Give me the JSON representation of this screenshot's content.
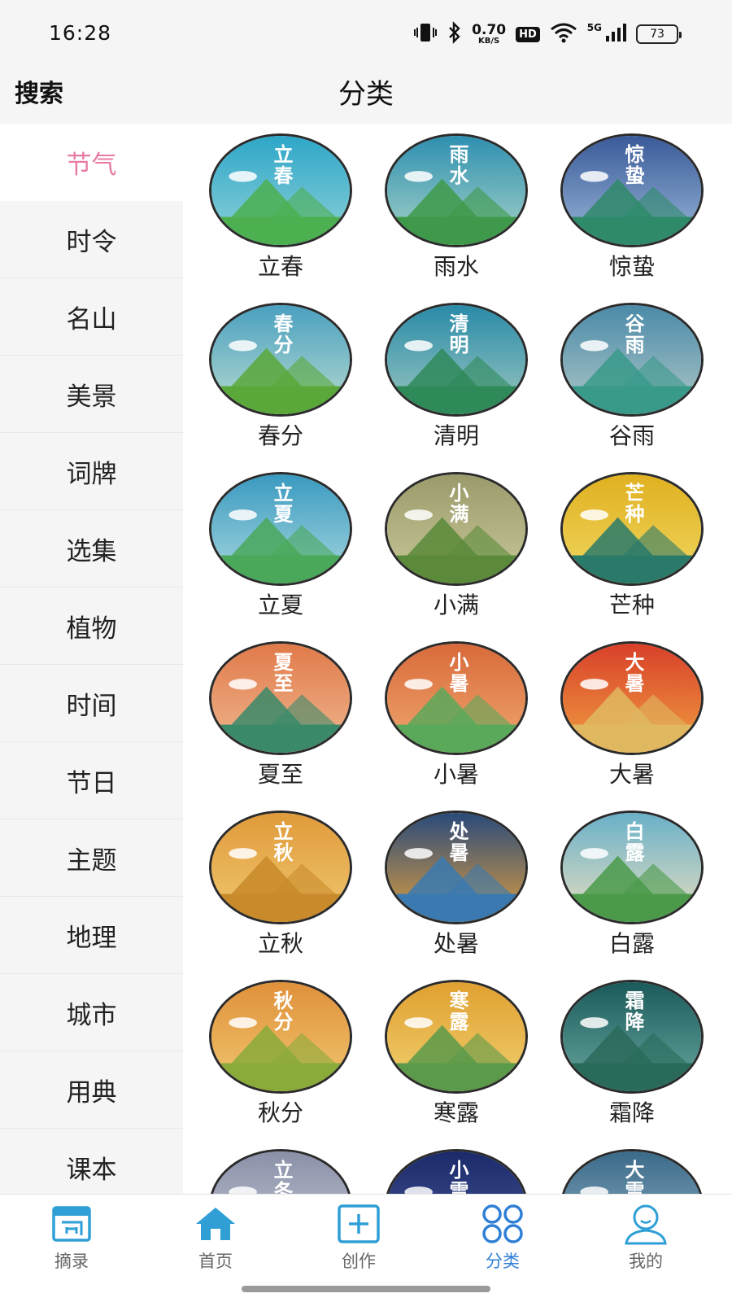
{
  "status": {
    "time": "16:28",
    "speed_value": "0.70",
    "speed_unit": "KB/S",
    "hd": "HD",
    "network": "5G",
    "battery": "73"
  },
  "header": {
    "search_label": "搜索",
    "title": "分类"
  },
  "sidebar": {
    "active_index": 0,
    "items": [
      {
        "label": "节气"
      },
      {
        "label": "时令"
      },
      {
        "label": "名山"
      },
      {
        "label": "美景"
      },
      {
        "label": "词牌"
      },
      {
        "label": "选集"
      },
      {
        "label": "植物"
      },
      {
        "label": "时间"
      },
      {
        "label": "节日"
      },
      {
        "label": "主题"
      },
      {
        "label": "地理"
      },
      {
        "label": "城市"
      },
      {
        "label": "用典"
      },
      {
        "label": "课本"
      }
    ]
  },
  "grid": {
    "items": [
      {
        "label": "立春",
        "colors": [
          "#2ea6c8",
          "#8fd2d8",
          "#4caf50"
        ]
      },
      {
        "label": "雨水",
        "colors": [
          "#2e8fb0",
          "#a8d4c8",
          "#3e9a4a"
        ]
      },
      {
        "label": "惊蛰",
        "colors": [
          "#3a5a9a",
          "#9ab8d8",
          "#2f8a6a"
        ]
      },
      {
        "label": "春分",
        "colors": [
          "#4aa0c0",
          "#b8dcd0",
          "#5aa83a"
        ]
      },
      {
        "label": "清明",
        "colors": [
          "#2a8aa8",
          "#9cc8c0",
          "#2f8a5a"
        ]
      },
      {
        "label": "谷雨",
        "colors": [
          "#4a8aa8",
          "#b0c8c8",
          "#3a9a8a"
        ]
      },
      {
        "label": "立夏",
        "colors": [
          "#3a9ac0",
          "#a8d8e0",
          "#4aa85a"
        ]
      },
      {
        "label": "小满",
        "colors": [
          "#9a9a6a",
          "#c8c89a",
          "#5a8a3a"
        ]
      },
      {
        "label": "芒种",
        "colors": [
          "#e0b020",
          "#f0d860",
          "#2a7a6a"
        ]
      },
      {
        "label": "夏至",
        "colors": [
          "#e07a4a",
          "#f0b890",
          "#3a8a6a"
        ]
      },
      {
        "label": "小暑",
        "colors": [
          "#d86a3a",
          "#f0a870",
          "#5aa85a"
        ]
      },
      {
        "label": "大暑",
        "colors": [
          "#d8402a",
          "#f0a040",
          "#e0b860"
        ]
      },
      {
        "label": "立秋",
        "colors": [
          "#e09a3a",
          "#f0c870",
          "#c88a2a"
        ]
      },
      {
        "label": "处暑",
        "colors": [
          "#2a4a7a",
          "#e0a040",
          "#3a7ab0"
        ]
      },
      {
        "label": "白露",
        "colors": [
          "#6ab0c8",
          "#e8e0c0",
          "#4a9a4a"
        ]
      },
      {
        "label": "秋分",
        "colors": [
          "#e0903a",
          "#f0c870",
          "#8aaa3a"
        ]
      },
      {
        "label": "寒露",
        "colors": [
          "#e0a030",
          "#f0d070",
          "#5a9a4a"
        ]
      },
      {
        "label": "霜降",
        "colors": [
          "#1a5a5a",
          "#6aa8a0",
          "#2a6a5a"
        ]
      },
      {
        "label": "立冬",
        "colors": [
          "#8a90a8",
          "#c8ccd8",
          "#6a7a8a"
        ]
      },
      {
        "label": "小雪",
        "colors": [
          "#1a2a6a",
          "#4a5a9a",
          "#2a3a7a"
        ]
      },
      {
        "label": "大雪",
        "colors": [
          "#3a6a8a",
          "#9ab8c8",
          "#5a7a8a"
        ]
      }
    ]
  },
  "tabbar": {
    "active_index": 3,
    "accent": "#2f7fd6",
    "tabs": [
      {
        "label": "摘录",
        "icon": "excerpt-icon"
      },
      {
        "label": "首页",
        "icon": "home-icon"
      },
      {
        "label": "创作",
        "icon": "create-icon"
      },
      {
        "label": "分类",
        "icon": "category-icon"
      },
      {
        "label": "我的",
        "icon": "profile-icon"
      }
    ]
  }
}
